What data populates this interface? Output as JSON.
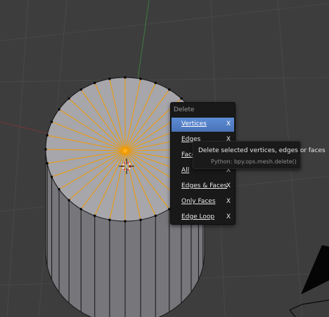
{
  "delete_menu": {
    "title": "Delete",
    "items": [
      {
        "label": "Vertices",
        "shortcut": "X",
        "active": true
      },
      {
        "label": "Edges",
        "shortcut": "X",
        "active": false
      },
      {
        "label": "Faces",
        "shortcut": "X",
        "active": false
      },
      {
        "label": "All",
        "shortcut": "X",
        "active": false
      },
      {
        "label": "Edges & Faces",
        "shortcut": "X",
        "active": false
      },
      {
        "label": "Only Faces",
        "shortcut": "X",
        "active": false
      },
      {
        "label": "Edge Loop",
        "shortcut": "X",
        "active": false
      }
    ]
  },
  "tooltip": {
    "description": "Delete selected vertices, edges or faces",
    "python": "Python: bpy.ops.mesh.delete()"
  },
  "colors": {
    "viewport_bg": "#3d3d3d",
    "grid": "#484848",
    "x_axis": "#7a3535",
    "y_axis": "#3f7a3f",
    "mesh_face": "#a6a6ab",
    "mesh_side": "#76767b",
    "mesh_edge": "#151515",
    "selected_edge": "#f29a00",
    "menu_highlight": "#5680c2"
  },
  "icons": [
    "3d-cursor-icon",
    "camera-object-icon"
  ]
}
